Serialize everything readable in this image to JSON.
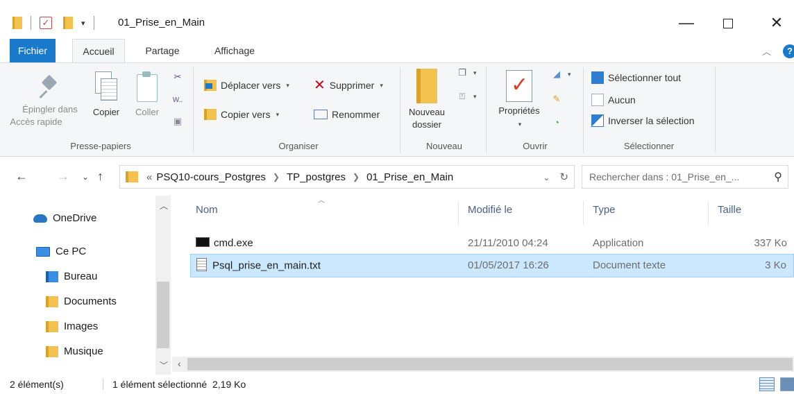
{
  "window": {
    "title": "01_Prise_en_Main",
    "min_glyph": "—",
    "close_glyph": "✕"
  },
  "tabs": {
    "file": "Fichier",
    "home": "Accueil",
    "share": "Partage",
    "view": "Affichage"
  },
  "ribbon": {
    "clipboard": {
      "pin_line1": "Épingler dans",
      "pin_line2": "Accès rapide",
      "copy": "Copier",
      "paste": "Coller",
      "label": "Presse-papiers"
    },
    "organize": {
      "move_to": "Déplacer vers",
      "copy_to": "Copier vers",
      "delete": "Supprimer",
      "rename": "Renommer",
      "label": "Organiser"
    },
    "new": {
      "new_folder_line1": "Nouveau",
      "new_folder_line2": "dossier",
      "label": "Nouveau"
    },
    "open": {
      "properties": "Propriétés",
      "label": "Ouvrir"
    },
    "select": {
      "select_all": "Sélectionner tout",
      "none": "Aucun",
      "invert": "Inverser la sélection",
      "label": "Sélectionner"
    }
  },
  "address": {
    "overflow": "«",
    "crumbs": [
      "PSQ10-cours_Postgres",
      "TP_postgres",
      "01_Prise_en_Main"
    ],
    "search_placeholder": "Rechercher dans : 01_Prise_en_..."
  },
  "nav": {
    "items": [
      "OneDrive",
      "Ce PC",
      "Bureau",
      "Documents",
      "Images",
      "Musique"
    ]
  },
  "filelist": {
    "columns": [
      "Nom",
      "Modifié le",
      "Type",
      "Taille"
    ],
    "rows": [
      {
        "name": "cmd.exe",
        "modified": "21/11/2010 04:24",
        "type": "Application",
        "size": "337 Ko",
        "icon": "console-icon"
      },
      {
        "name": "Psql_prise_en_main.txt",
        "modified": "01/05/2017 16:26",
        "type": "Document texte",
        "size": "3 Ko",
        "icon": "text-file-icon",
        "selected": true
      }
    ]
  },
  "status": {
    "count": "2 élément(s)",
    "selection": "1 élément sélectionné  2,19 Ko"
  },
  "colors": {
    "accent": "#1979ca",
    "selection": "#cce8ff"
  }
}
